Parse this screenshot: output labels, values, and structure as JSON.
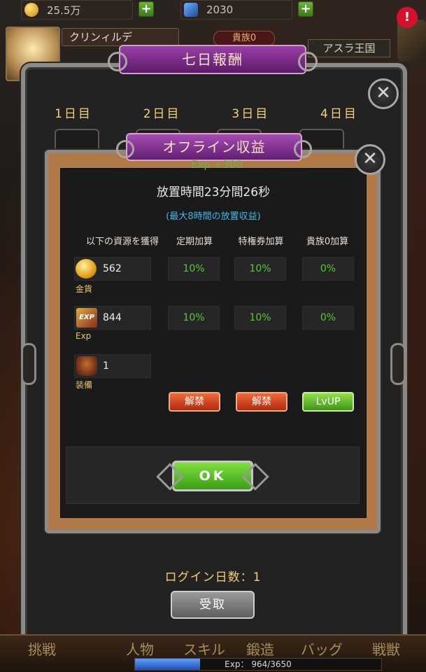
{
  "resources": {
    "gold": "25.5万",
    "gems": "2030",
    "plus": "+"
  },
  "alert_badge": "!",
  "player": {
    "name": "クリンィルデ",
    "noble": "貴族0",
    "kingdom": "アスラ王国"
  },
  "seven_day": {
    "title": "七日報酬",
    "days": [
      "1日目",
      "2日目",
      "3日目",
      "4日目"
    ],
    "login_days": "ログイン日数：1",
    "receive_label": "受取",
    "close": "✕"
  },
  "offline": {
    "title": "オフライン収益",
    "exp_float": "Exp +300",
    "idle_time": "放置時間23分間26秒",
    "max_note": "(最大8時間の放置収益)",
    "close": "✕",
    "columns": [
      "以下の資源を獲得",
      "定期加算",
      "特権券加算",
      "貴族0加算"
    ],
    "rows": [
      {
        "label": "金貨",
        "value": "562",
        "periodic": "10%",
        "pass": "10%",
        "noble": "0%",
        "icon": "gold-coin-icon"
      },
      {
        "label": "Exp",
        "value": "844",
        "periodic": "10%",
        "pass": "10%",
        "noble": "0%",
        "icon": "exp-icon"
      },
      {
        "label": "装備",
        "value": "1",
        "icon": "armor-icon"
      }
    ],
    "buttons": {
      "unlock1": "解禁",
      "unlock2": "解禁",
      "lvup": "LvUP"
    },
    "ok_label": "OK"
  },
  "bottom_nav": {
    "items": [
      "挑戦",
      "人物",
      "スキル",
      "鍛造",
      "バッグ",
      "戦獣"
    ],
    "exp_label": "Exp：",
    "exp_value": "964/3650",
    "exp_progress": 0.264
  }
}
